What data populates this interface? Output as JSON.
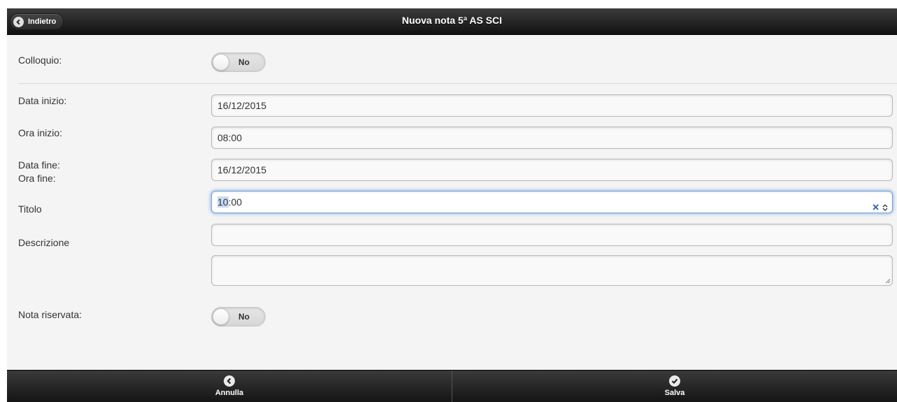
{
  "header": {
    "title": "Nuova nota 5ª AS SCI",
    "back_label": "Indietro"
  },
  "form": {
    "colloquio": {
      "label": "Colloquio:",
      "value": "No"
    },
    "data_inizio": {
      "label": "Data inizio:",
      "value": "16/12/2015"
    },
    "ora_inizio": {
      "label": "Ora inizio:",
      "value": "08:00"
    },
    "data_fine": {
      "label": "Data fine:",
      "value": "16/12/2015"
    },
    "ora_fine": {
      "label": "Ora fine:",
      "value_selected": "10",
      "value_rest": ":00"
    },
    "titolo": {
      "label": "Titolo",
      "value": ""
    },
    "descrizione": {
      "label": "Descrizione",
      "value": ""
    },
    "nota_riservata": {
      "label": "Nota riservata:",
      "value": "No"
    }
  },
  "footer": {
    "cancel_label": "Annulla",
    "save_label": "Salva"
  }
}
